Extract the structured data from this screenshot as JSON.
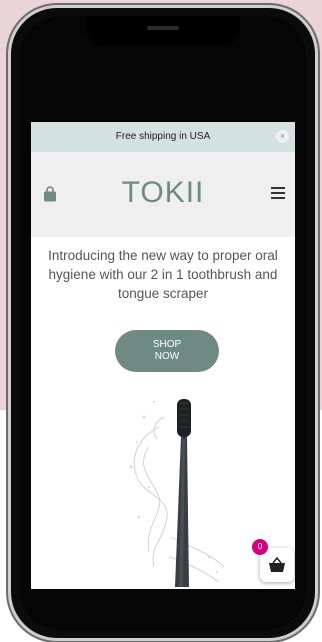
{
  "announcement": {
    "text": "Free shipping in USA",
    "close_symbol": "×"
  },
  "header": {
    "logo": "TOKII",
    "left_icon": "shopping-bag-icon",
    "right_icon": "hamburger-menu-icon"
  },
  "hero": {
    "text": "Introducing the new way to proper oral hygiene with our 2 in 1 toothbrush and tongue scraper",
    "button_label": "SHOP NOW",
    "image": "toothbrush-splash"
  },
  "cart": {
    "count": "0",
    "icon": "basket-icon"
  },
  "colors": {
    "accent": "#6f8a83",
    "announcement_bg": "#d4e2df",
    "badge": "#d5007b",
    "page_bg": "#ebd3da"
  }
}
